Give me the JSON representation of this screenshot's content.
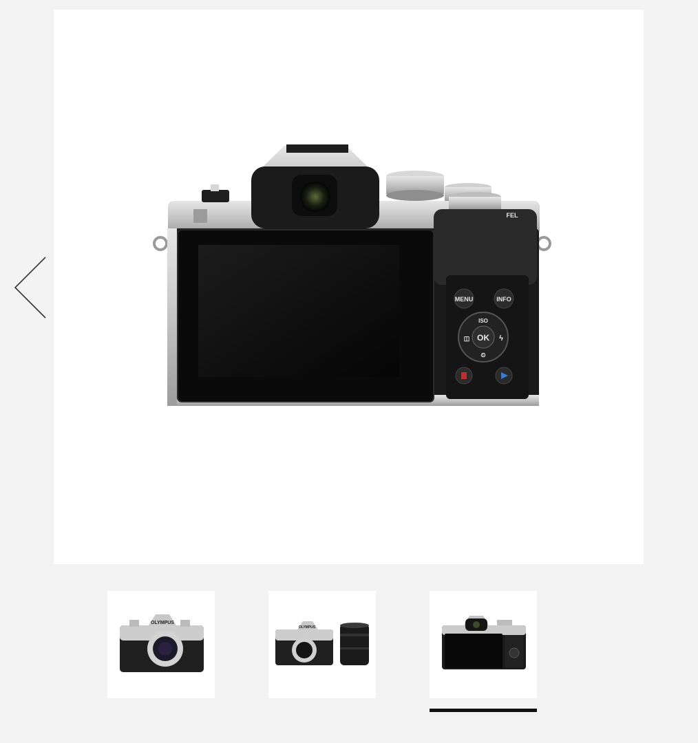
{
  "gallery": {
    "current_index": 3,
    "total": 3,
    "main_image": {
      "alt": "Camera rear view",
      "button_labels": {
        "menu": "MENU",
        "info": "INFO",
        "ok": "OK",
        "iso": "ISO",
        "fel": "FEL"
      }
    },
    "thumbnails": [
      {
        "alt": "Camera front view",
        "logo_text": "OLYMPUS",
        "selected": false
      },
      {
        "alt": "Camera with kit lenses",
        "logo_text": "OLYMPUS",
        "selected": false
      },
      {
        "alt": "Camera rear view",
        "selected": true
      }
    ],
    "prev_icon": "chevron-left-icon"
  },
  "colors": {
    "page_bg": "#f3f3f3",
    "card_bg": "#ffffff",
    "camera_silver": "#c9c9c9",
    "camera_black": "#1a1a1a",
    "indicator": "#111111",
    "arrow": "#333333"
  }
}
